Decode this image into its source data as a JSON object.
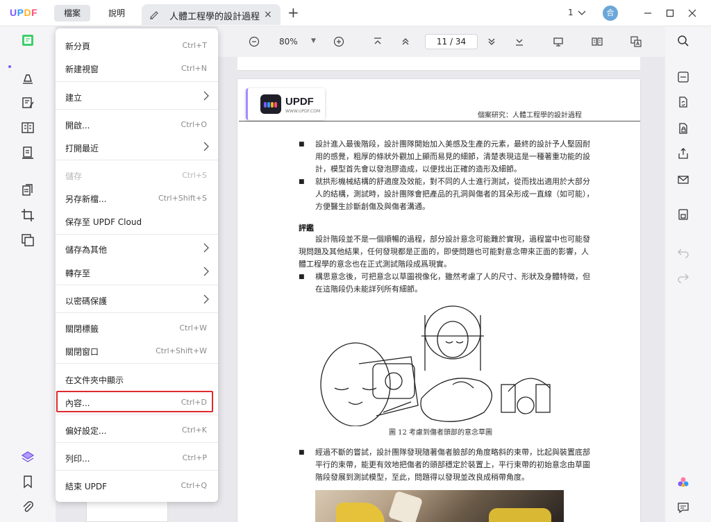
{
  "app": {
    "logo": "UPDF"
  },
  "titlebar": {
    "menus": [
      "檔案",
      "說明"
    ],
    "tab_title": "人體工程學的設計過程",
    "tab_close": "×",
    "tab_add": "+",
    "page_count": "1",
    "avatar_initial": "合"
  },
  "toolbar": {
    "zoom": "80%",
    "zoom_dropdown": "▼",
    "page": "11 / 34"
  },
  "menu": {
    "items": [
      {
        "label": "新分頁",
        "shortcut": "Ctrl+T"
      },
      {
        "label": "新建視窗",
        "shortcut": "Ctrl+N"
      },
      {
        "label": "建立",
        "shortcut": ""
      },
      {
        "label": "開啟...",
        "shortcut": "Ctrl+O"
      },
      {
        "label": "打開最近",
        "shortcut": ""
      },
      {
        "label": "儲存",
        "shortcut": "Ctrl+S"
      },
      {
        "label": "另存新檔...",
        "shortcut": "Ctrl+Shift+S"
      },
      {
        "label": "保存至 UPDF Cloud",
        "shortcut": ""
      },
      {
        "label": "儲存為其他",
        "shortcut": ""
      },
      {
        "label": "轉存至",
        "shortcut": ""
      },
      {
        "label": "以密碼保護",
        "shortcut": ""
      },
      {
        "label": "關閉標籤",
        "shortcut": "Ctrl+W"
      },
      {
        "label": "關閉窗口",
        "shortcut": "Ctrl+Shift+W"
      },
      {
        "label": "在文件夾中顯示",
        "shortcut": ""
      },
      {
        "label": "內容...",
        "shortcut": "Ctrl+D"
      },
      {
        "label": "偏好設定...",
        "shortcut": "Ctrl+K"
      },
      {
        "label": "列印...",
        "shortcut": "Ctrl+P"
      },
      {
        "label": "結束 UPDF",
        "shortcut": "Ctrl+Q"
      }
    ]
  },
  "document": {
    "badge_brand": "UPDF",
    "badge_url": "WWW.UPDF.COM",
    "header": "個案研究：人體工程學的設計過程",
    "p1": [
      "設計進入最後階段，設計團隊開始加入美感及生產的元素，最終的設計予人堅固耐",
      "用的感覺，粗厚的條狀外觀加上顯而易見的細節，清楚表現這是一種著重功能的設",
      "計，模型首先會以發泡膠造成，以便找出正確的造形及細節。"
    ],
    "p2": [
      "就拱形機械結構的舒適度及效能，對不同的人士進行測試，從而找出適用於大部分",
      "人的結構，測試時，設計團隊會把產品的孔洞與傷者的耳朵形成一直線（如可能），",
      "方便醫生診斷創傷及與傷者溝通。"
    ],
    "heading": "評鑑",
    "p3": [
      "設計階段並不是一個順暢的過程，部分設計意念可能難於實現，過程當中也可能發",
      "現問題及其他結果，任何發現都是正面的，即使問題也可能對意念帶來正面的影響，人",
      "體工程學的意念也在正式測試階段成爲現實。"
    ],
    "p4": [
      "構思意念後，可把意念以草圖視像化，雖然考慮了人的尺寸、形狀及身體特徵，但",
      "在這階段仍未能詳列所有細節。"
    ],
    "caption": "圖 12  考慮到傷者頭部的意念草圖",
    "p5": [
      "經過不斷的嘗試，設計團隊發現隨著傷者臉部的角度略斜的束帶，比起與裝置底部",
      "平行的束帶，能更有效地把傷者的頭部穩定於裝置上，平行束帶的初始意念由草圖",
      "階段發展到測試模型，至此，問題得以發現並改良成稍帶角度。"
    ],
    "bullet": "■"
  },
  "colors": {
    "accent": "#7b5cff",
    "highlight": "#e0282e"
  }
}
